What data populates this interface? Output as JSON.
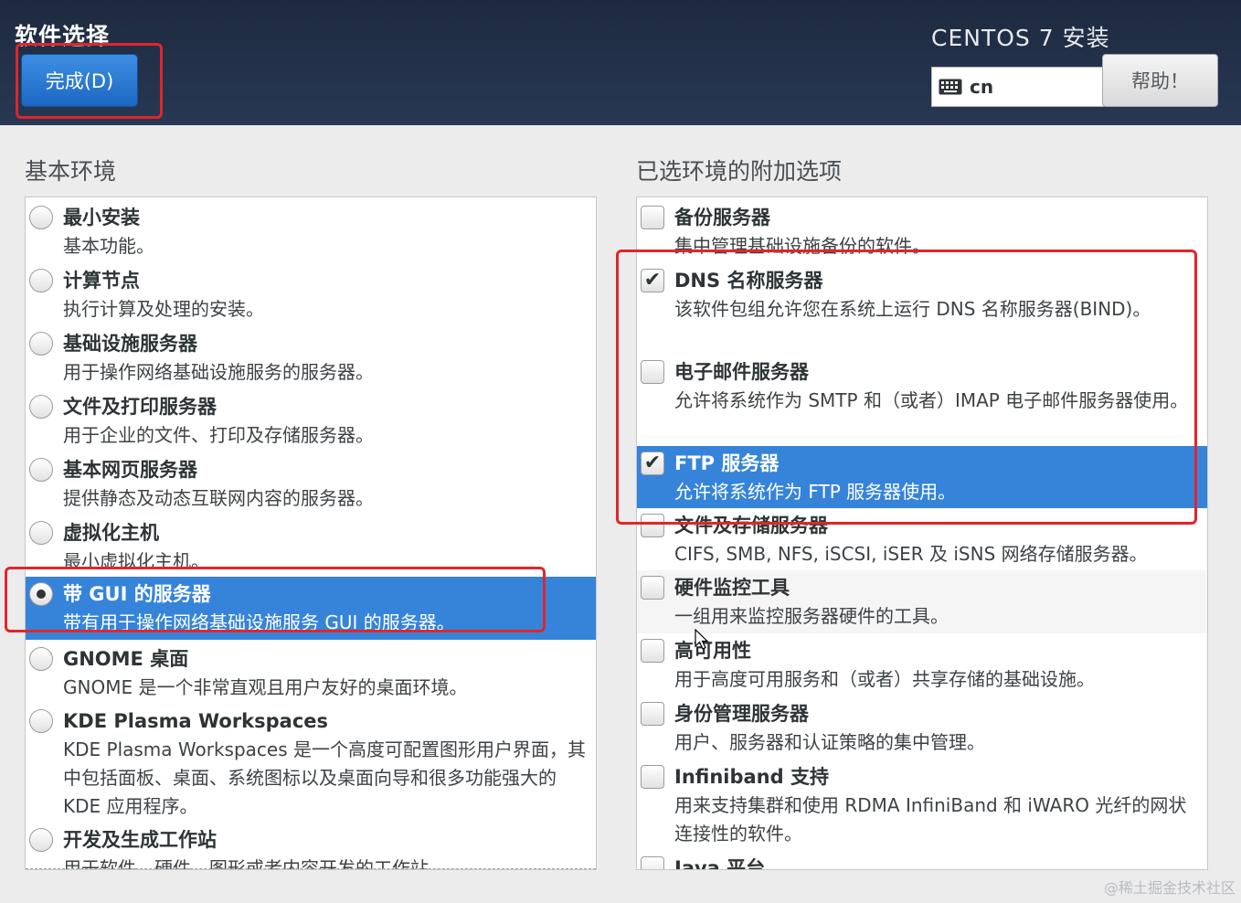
{
  "header": {
    "title": "软件选择",
    "done_label": "完成(D)",
    "product": "CENTOS 7 安装",
    "keyboard_layout": "cn",
    "help_label": "帮助！",
    "keyboard_icon": "keyboard-icon"
  },
  "left": {
    "heading": "基本环境",
    "items": [
      {
        "name": "最小安装",
        "desc": "基本功能。",
        "selected": false
      },
      {
        "name": "计算节点",
        "desc": "执行计算及处理的安装。",
        "selected": false
      },
      {
        "name": "基础设施服务器",
        "desc": "用于操作网络基础设施服务的服务器。",
        "selected": false
      },
      {
        "name": "文件及打印服务器",
        "desc": "用于企业的文件、打印及存储服务器。",
        "selected": false
      },
      {
        "name": "基本网页服务器",
        "desc": "提供静态及动态互联网内容的服务器。",
        "selected": false
      },
      {
        "name": "虚拟化主机",
        "desc": "最小虚拟化主机。",
        "selected": false
      },
      {
        "name": "带 GUI 的服务器",
        "desc": "带有用于操作网络基础设施服务 GUI 的服务器。",
        "selected": true
      },
      {
        "name": "GNOME 桌面",
        "desc": "GNOME 是一个非常直观且用户友好的桌面环境。",
        "selected": false
      },
      {
        "name": "KDE Plasma Workspaces",
        "desc": "KDE Plasma Workspaces 是一个高度可配置图形用户界面，其中包括面板、桌面、系统图标以及桌面向导和很多功能强大的 KDE 应用程序。",
        "selected": false
      },
      {
        "name": "开发及生成工作站",
        "desc": "用于软件、硬件、图形或者内容开发的工作站。",
        "selected": false
      }
    ]
  },
  "right": {
    "heading": "已选环境的附加选项",
    "items": [
      {
        "name": "备份服务器",
        "desc": "集中管理基础设施备份的软件。",
        "checked": false
      },
      {
        "name": "DNS 名称服务器",
        "desc": "该软件包组允许您在系统上运行 DNS 名称服务器(BIND)。",
        "checked": true
      },
      {
        "name": "电子邮件服务器",
        "desc": "允许将系统作为 SMTP 和（或者）IMAP 电子邮件服务器使用。",
        "checked": false
      },
      {
        "name": "FTP 服务器",
        "desc": "允许将系统作为 FTP 服务器使用。",
        "checked": true
      },
      {
        "name": "文件及存储服务器",
        "desc": "CIFS, SMB, NFS, iSCSI, iSER 及 iSNS 网络存储服务器。",
        "checked": false
      },
      {
        "name": "硬件监控工具",
        "desc": "一组用来监控服务器硬件的工具。",
        "checked": false
      },
      {
        "name": "高可用性",
        "desc": "用于高度可用服务和（或者）共享存储的基础设施。",
        "checked": false
      },
      {
        "name": "身份管理服务器",
        "desc": "用户、服务器和认证策略的集中管理。",
        "checked": false
      },
      {
        "name": "Infiniband 支持",
        "desc": "用来支持集群和使用 RDMA InfiniBand 和 iWARO 光纤的网状连接性的软件。",
        "checked": false
      },
      {
        "name": "Java 平台",
        "desc": "",
        "checked": false
      }
    ]
  },
  "watermark": "@稀土掘金技术社区",
  "colors": {
    "header_bg": "#1d2a3f",
    "accent": "#3584d9",
    "annotation": "#e0262b"
  }
}
